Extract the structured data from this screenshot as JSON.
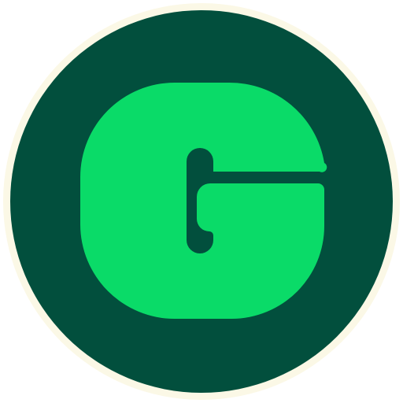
{
  "logo": {
    "icon": "g-letter-logo-icon",
    "letter": "G",
    "colors": {
      "ring": "#FBF8E6",
      "background": "#024F3D",
      "letter": "#0ADB68"
    }
  }
}
